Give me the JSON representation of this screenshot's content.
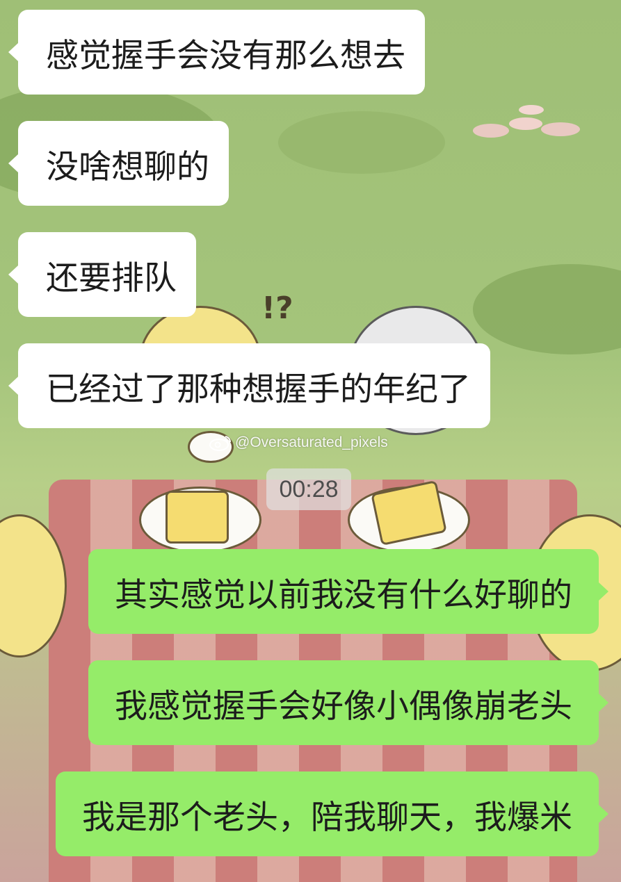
{
  "conversation": {
    "messages": [
      {
        "direction": "incoming",
        "text": "感觉握手会没有那么想去"
      },
      {
        "direction": "incoming",
        "text": "没啥想聊的"
      },
      {
        "direction": "incoming",
        "text": "还要排队"
      },
      {
        "direction": "incoming",
        "text": "已经过了那种想握手的年纪了"
      },
      {
        "direction": "outgoing",
        "text": "其实感觉以前我没有什么好聊的"
      },
      {
        "direction": "outgoing",
        "text": "我感觉握手会好像小偶像崩老头"
      },
      {
        "direction": "outgoing",
        "text": "我是那个老头，陪我聊天，我爆米"
      }
    ],
    "time_divider": "00:28"
  },
  "watermark": {
    "text": "@Oversaturated_pixels",
    "icon": "weibo-logo-icon"
  },
  "background": {
    "icon": "cartoon-picnic-wallpaper"
  },
  "colors": {
    "incoming_bubble": "#ffffff",
    "outgoing_bubble": "#95ec69",
    "wallpaper_green": "#a4c47b"
  }
}
